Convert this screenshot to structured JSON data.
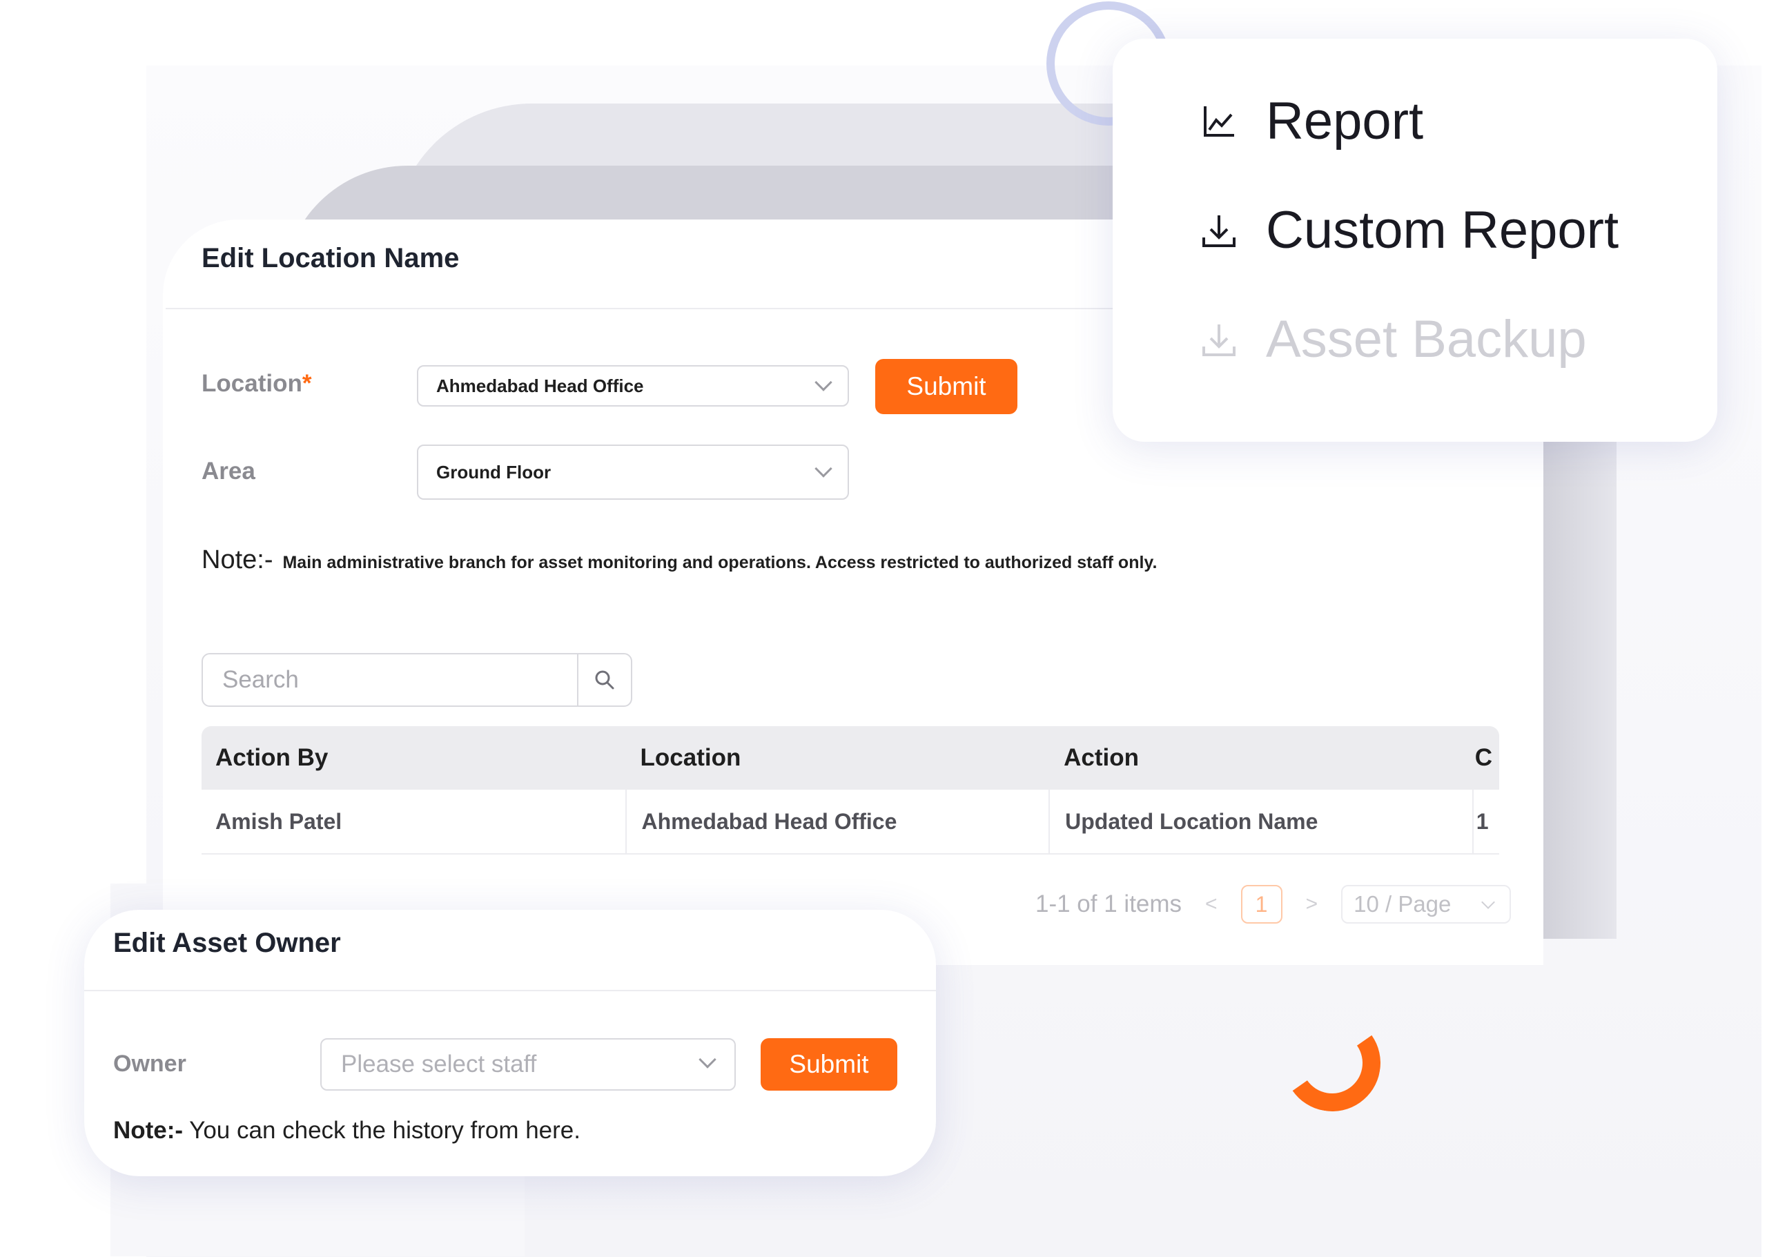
{
  "edit_location": {
    "title": "Edit Location Name",
    "location_label": "Location",
    "required_mark": "*",
    "location_value": "Ahmedabad Head Office",
    "area_label": "Area",
    "area_value": "Ground Floor",
    "submit_label": "Submit",
    "note_label": "Note:-",
    "note_text": "Main administrative branch for asset monitoring and operations. Access restricted to authorized staff only."
  },
  "search": {
    "placeholder": "Search",
    "icon": "search-icon"
  },
  "table": {
    "headers": [
      "Action By",
      "Location",
      "Action",
      "C"
    ],
    "rows": [
      [
        "Amish Patel",
        "Ahmedabad Head Office",
        "Updated Location Name",
        "1"
      ]
    ]
  },
  "pagination": {
    "summary": "1-1 of 1 items",
    "prev": "<",
    "current_page": "1",
    "next": ">",
    "page_size": "10 / Page"
  },
  "menu": {
    "items": [
      {
        "label": "Report",
        "icon": "chart-icon",
        "enabled": true
      },
      {
        "label": "Custom Report",
        "icon": "download-icon",
        "enabled": true
      },
      {
        "label": "Asset Backup",
        "icon": "download-icon",
        "enabled": false
      }
    ]
  },
  "edit_owner": {
    "title": "Edit Asset Owner",
    "owner_label": "Owner",
    "owner_placeholder": "Please select staff",
    "submit_label": "Submit",
    "note_label": "Note:-",
    "note_text": " You can check the history from here."
  },
  "colors": {
    "accent": "#ff6a13",
    "header_bg": "#ececef",
    "ring": "#cdd2ef"
  }
}
